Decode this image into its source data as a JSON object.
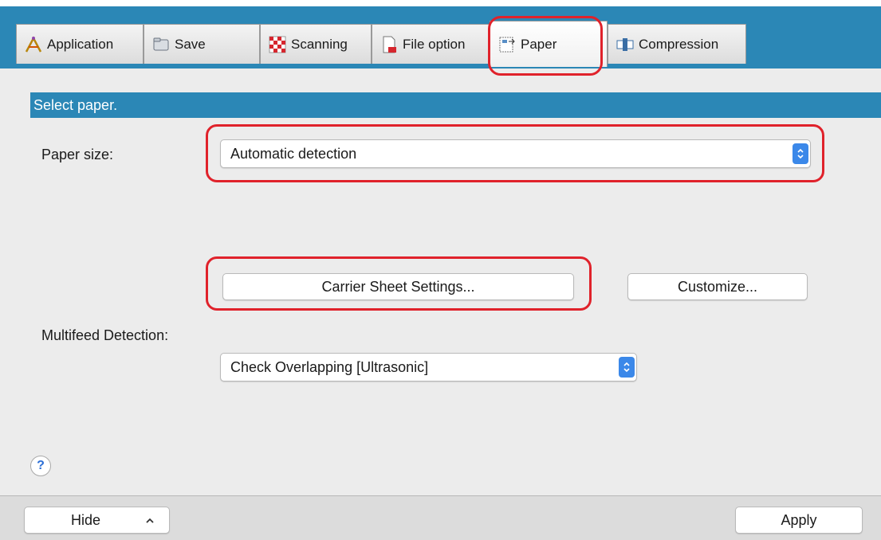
{
  "tabs": [
    {
      "label": "Application",
      "icon": "application-icon"
    },
    {
      "label": "Save",
      "icon": "folder-icon"
    },
    {
      "label": "Scanning",
      "icon": "scanning-icon"
    },
    {
      "label": "File option",
      "icon": "file-option-icon"
    },
    {
      "label": "Paper",
      "icon": "paper-icon",
      "active": true
    },
    {
      "label": "Compression",
      "icon": "compression-icon"
    }
  ],
  "section": {
    "title": "Select paper."
  },
  "paper_size": {
    "label": "Paper size:",
    "value": "Automatic detection"
  },
  "buttons": {
    "carrier_sheet": "Carrier Sheet Settings...",
    "customize": "Customize..."
  },
  "multifeed": {
    "label": "Multifeed Detection:",
    "value": "Check Overlapping [Ultrasonic]"
  },
  "footer": {
    "help": "?",
    "hide": "Hide",
    "apply": "Apply"
  },
  "colors": {
    "accent": "#2b87b6",
    "highlight": "#e0222b",
    "stepper": "#3b88e9"
  }
}
